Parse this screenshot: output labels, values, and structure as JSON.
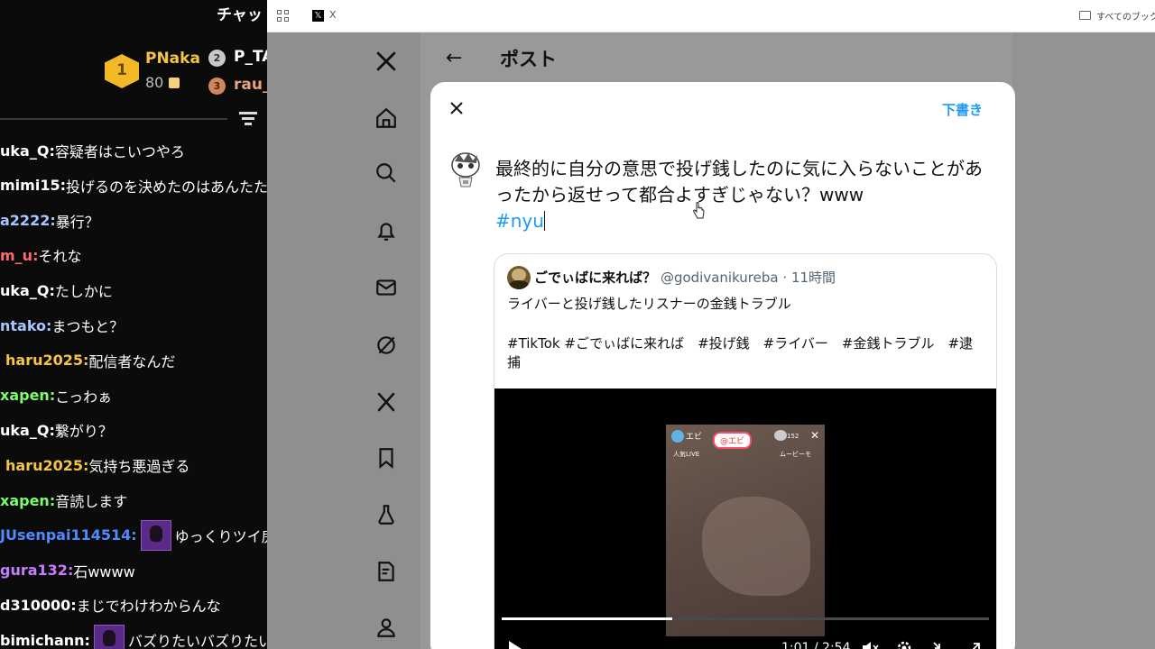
{
  "chat": {
    "header": "チャッ",
    "leaderboard": {
      "first": {
        "rank": "1",
        "name": "PNaka",
        "points": "80"
      },
      "second": {
        "rank": "2",
        "name": "P_TA"
      },
      "third": {
        "rank": "3",
        "name": "rau_"
      }
    },
    "messages": [
      {
        "name": "uka_Q",
        "text": "容疑者はこいつやろ",
        "color": "#ffffff",
        "emote": false
      },
      {
        "name": "mimi15",
        "text": "投げるのを決めたのはあんたた",
        "color": "#ffffff",
        "emote": false
      },
      {
        "name": "a2222",
        "text": "暴行？",
        "color": "#a9c7ff",
        "emote": false
      },
      {
        "name": "m_u",
        "text": "それな",
        "color": "#ff6b6b",
        "emote": false
      },
      {
        "name": "uka_Q",
        "text": "たしかに",
        "color": "#ffffff",
        "emote": false
      },
      {
        "name": "ntako",
        "text": "まつもと？",
        "color": "#a9c7ff",
        "emote": false
      },
      {
        "name": "haru2025",
        "text": "配信者なんだ",
        "color": "#f5c542",
        "emote": false
      },
      {
        "name": "xapen",
        "text": "こっわぁ",
        "color": "#7cfc6b",
        "emote": false
      },
      {
        "name": "uka_Q",
        "text": "繋がり？",
        "color": "#ffffff",
        "emote": false
      },
      {
        "name": "haru2025",
        "text": "気持ち悪過ぎる",
        "color": "#f5c542",
        "emote": false
      },
      {
        "name": "xapen",
        "text": "音読します",
        "color": "#7cfc6b",
        "emote": false
      },
      {
        "name": "JUsenpai114514",
        "text": "ゆっくりツイ房",
        "color": "#4d8bff",
        "emote": true
      },
      {
        "name": "gura132",
        "text": "石wwww",
        "color": "#c77dff",
        "emote": false
      },
      {
        "name": "d310000",
        "text": "まじでわけわからんな",
        "color": "#ffffff",
        "emote": false
      },
      {
        "name": "bimichann",
        "text": "バズりたいバズりたい",
        "color": "#ffffff",
        "emote": true
      }
    ]
  },
  "browser": {
    "bookmark_x_label": "X",
    "all_bookmarks_label": "すべてのブックマ"
  },
  "x": {
    "header_title": "ポスト",
    "nav_icons": [
      "x-logo-icon",
      "home-icon",
      "search-icon",
      "notifications-icon",
      "messages-icon",
      "grok-icon",
      "premium-x-icon",
      "bookmarks-icon",
      "jobs-icon",
      "articles-icon",
      "profile-icon"
    ],
    "compose": {
      "drafts_label": "下書き",
      "text": "最終的に自分の意思で投げ銭したのに気に入らないことがあったから返せって都合よすぎじゃない？www",
      "hashtag": "#nyu"
    },
    "quote": {
      "name": "ごでぃばに来れば？",
      "handle": "@godivanikureba",
      "dot": "·",
      "time": "11時間",
      "text1": "ライバーと投げ銭したリスナーの金銭トラブル",
      "text2": "#TikTok #ごでぃばに来れば　#投げ銭　#ライバー　#金銭トラブル　#逮捕",
      "video": {
        "overlay_ebi": "エビ",
        "overlay_tag": "@エビ",
        "overlay_count": "152",
        "overlay_sub1": "人気LIVE",
        "overlay_sub2": "ムービーモ",
        "time": "1:01 / 2:54",
        "progress_fraction": 0.35
      }
    }
  }
}
